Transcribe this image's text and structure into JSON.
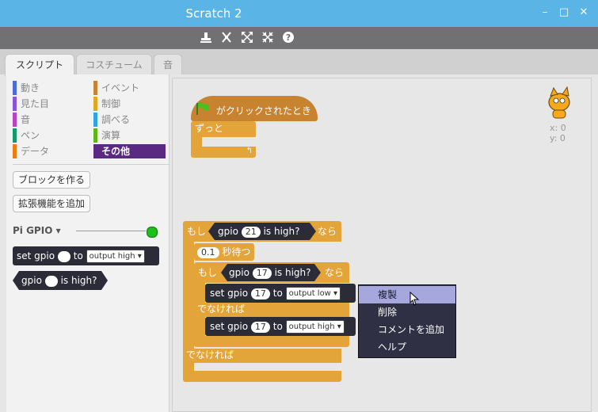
{
  "window": {
    "title": "Scratch 2",
    "minimize": "–",
    "maximize": "□",
    "close": "✕"
  },
  "tabs": [
    {
      "label": "スクリプト"
    },
    {
      "label": "コスチューム"
    },
    {
      "label": "音"
    }
  ],
  "categories": {
    "left": [
      "動き",
      "見た目",
      "音",
      "ペン",
      "データ"
    ],
    "right": [
      "イベント",
      "制御",
      "調べる",
      "演算",
      "その他"
    ]
  },
  "palette": {
    "make_block": "ブロックを作る",
    "add_extension": "拡張機能を追加",
    "extension_name": "Pi GPIO ▾",
    "set_block": {
      "set": "set",
      "gpio": "gpio",
      "to": "to",
      "output": "output high"
    },
    "high_block": {
      "gpio": "gpio",
      "is_high": "is high?"
    }
  },
  "stage": {
    "sprite_x_label": "x: 0",
    "sprite_y_label": "y: 0"
  },
  "script1": {
    "hat": "がクリックされたとき",
    "forever": "ずっと"
  },
  "script2": {
    "if_label": "もし",
    "then_label": "なら",
    "gpio": "gpio",
    "pin21": "21",
    "is_high": "is high?",
    "wait_value": "0.1",
    "wait_label": "秒待つ",
    "pin17": "17",
    "set": "set",
    "to": "to",
    "output_low": "output low",
    "output_high": "output high",
    "else_label": "でなければ"
  },
  "context_menu": {
    "items": [
      "複製",
      "削除",
      "コメントを追加",
      "ヘルプ"
    ]
  },
  "colors": {
    "accent_title": "#5bb4e6",
    "control": "#e3a43a",
    "more_blocks": "#5a2a82",
    "extension_block": "#2c2c39"
  }
}
